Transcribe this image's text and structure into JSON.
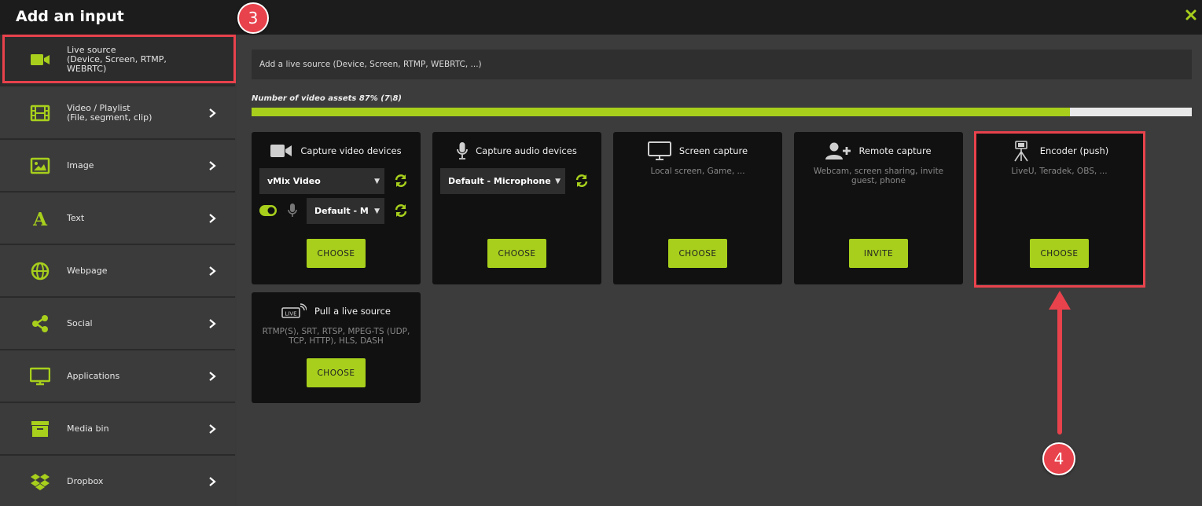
{
  "window": {
    "title": "Add an input"
  },
  "sidebar": {
    "items": [
      {
        "label": "Live source\n(Device, Screen, RTMP,\nWEBRTC)",
        "icon": "video-camera-icon",
        "active": true
      },
      {
        "label": "Video / Playlist\n(File, segment, clip)",
        "icon": "film-icon"
      },
      {
        "label": "Image",
        "icon": "image-icon"
      },
      {
        "label": "Text",
        "icon": "text-a-icon"
      },
      {
        "label": "Webpage",
        "icon": "globe-icon"
      },
      {
        "label": "Social",
        "icon": "share-icon"
      },
      {
        "label": "Applications",
        "icon": "monitor-icon"
      },
      {
        "label": "Media bin",
        "icon": "archive-box-icon"
      },
      {
        "label": "Dropbox",
        "icon": "dropbox-icon"
      }
    ]
  },
  "search": {
    "placeholder": "Add a live source (Device, Screen, RTMP, WEBRTC, ...)"
  },
  "progress": {
    "label": "Number of video assets 87% (7\\8)",
    "percent": 87
  },
  "cards": {
    "capture_video": {
      "title": "Capture video devices",
      "video_select": "vMix Video",
      "audio_select": "Default - M",
      "button": "CHOOSE"
    },
    "capture_audio": {
      "title": "Capture audio devices",
      "audio_select": "Default - Microphone",
      "button": "CHOOSE"
    },
    "screen_capture": {
      "title": "Screen capture",
      "subtitle": "Local screen, Game, ...",
      "button": "CHOOSE"
    },
    "remote_capture": {
      "title": "Remote capture",
      "subtitle": "Webcam, screen sharing, invite guest, phone",
      "button": "INVITE"
    },
    "encoder": {
      "title": "Encoder (push)",
      "subtitle": "LiveU, Teradek, OBS, ...",
      "button": "CHOOSE"
    },
    "pull_live": {
      "title": "Pull a live source",
      "subtitle": "RTMP(S), SRT, RTSP, MPEG-TS (UDP, TCP, HTTP), HLS, DASH",
      "button": "CHOOSE"
    }
  },
  "annotations": {
    "step3": "3",
    "step4": "4"
  },
  "colors": {
    "accent": "#a7cf1c",
    "annotation": "#e8424c"
  }
}
